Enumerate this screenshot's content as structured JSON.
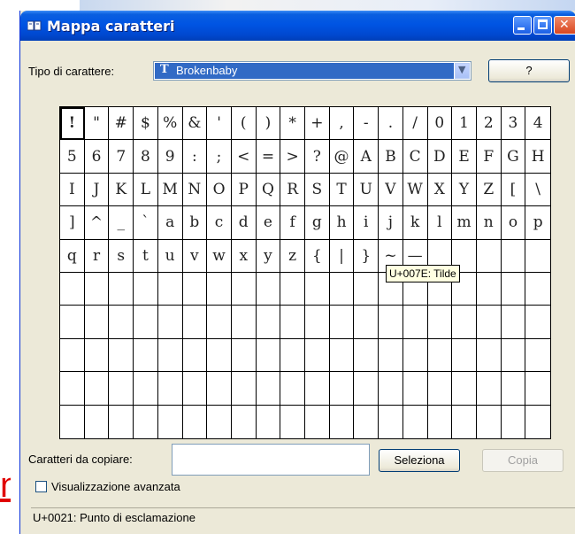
{
  "window": {
    "title": "Mappa caratteri",
    "controls": [
      "minimize",
      "maximize",
      "close"
    ]
  },
  "font_row": {
    "label": "Tipo di carattere:",
    "selected_font": "Brokenbaby",
    "help_label": "?"
  },
  "grid": {
    "columns": 20,
    "rows": 10,
    "selected_index": 0,
    "chars": [
      "!",
      "\"",
      "#",
      "$",
      "%",
      "&",
      "'",
      "(",
      ")",
      "*",
      "+",
      ",",
      "-",
      ".",
      "/",
      "0",
      "1",
      "2",
      "3",
      "4",
      "5",
      "6",
      "7",
      "8",
      "9",
      ":",
      ";",
      "<",
      "=",
      ">",
      "?",
      "@",
      "A",
      "B",
      "C",
      "D",
      "E",
      "F",
      "G",
      "H",
      "I",
      "J",
      "K",
      "L",
      "M",
      "N",
      "O",
      "P",
      "Q",
      "R",
      "S",
      "T",
      "U",
      "V",
      "W",
      "X",
      "Y",
      "Z",
      "[",
      "\\",
      "]",
      "^",
      "_",
      "`",
      "a",
      "b",
      "c",
      "d",
      "e",
      "f",
      "g",
      "h",
      "i",
      "j",
      "k",
      "l",
      "m",
      "n",
      "o",
      "p",
      "q",
      "r",
      "s",
      "t",
      "u",
      "v",
      "w",
      "x",
      "y",
      "z",
      "{",
      "|",
      "}",
      "~",
      "—"
    ]
  },
  "tooltip": "U+007E: Tilde",
  "copy_row": {
    "label": "Caratteri da copiare:",
    "value": "",
    "select_label": "Seleziona",
    "copy_label": "Copia"
  },
  "advanced": {
    "label": "Visualizzazione avanzata",
    "checked": false
  },
  "status": "U+0021: Punto di esclamazione",
  "left_fragment": "n"
}
